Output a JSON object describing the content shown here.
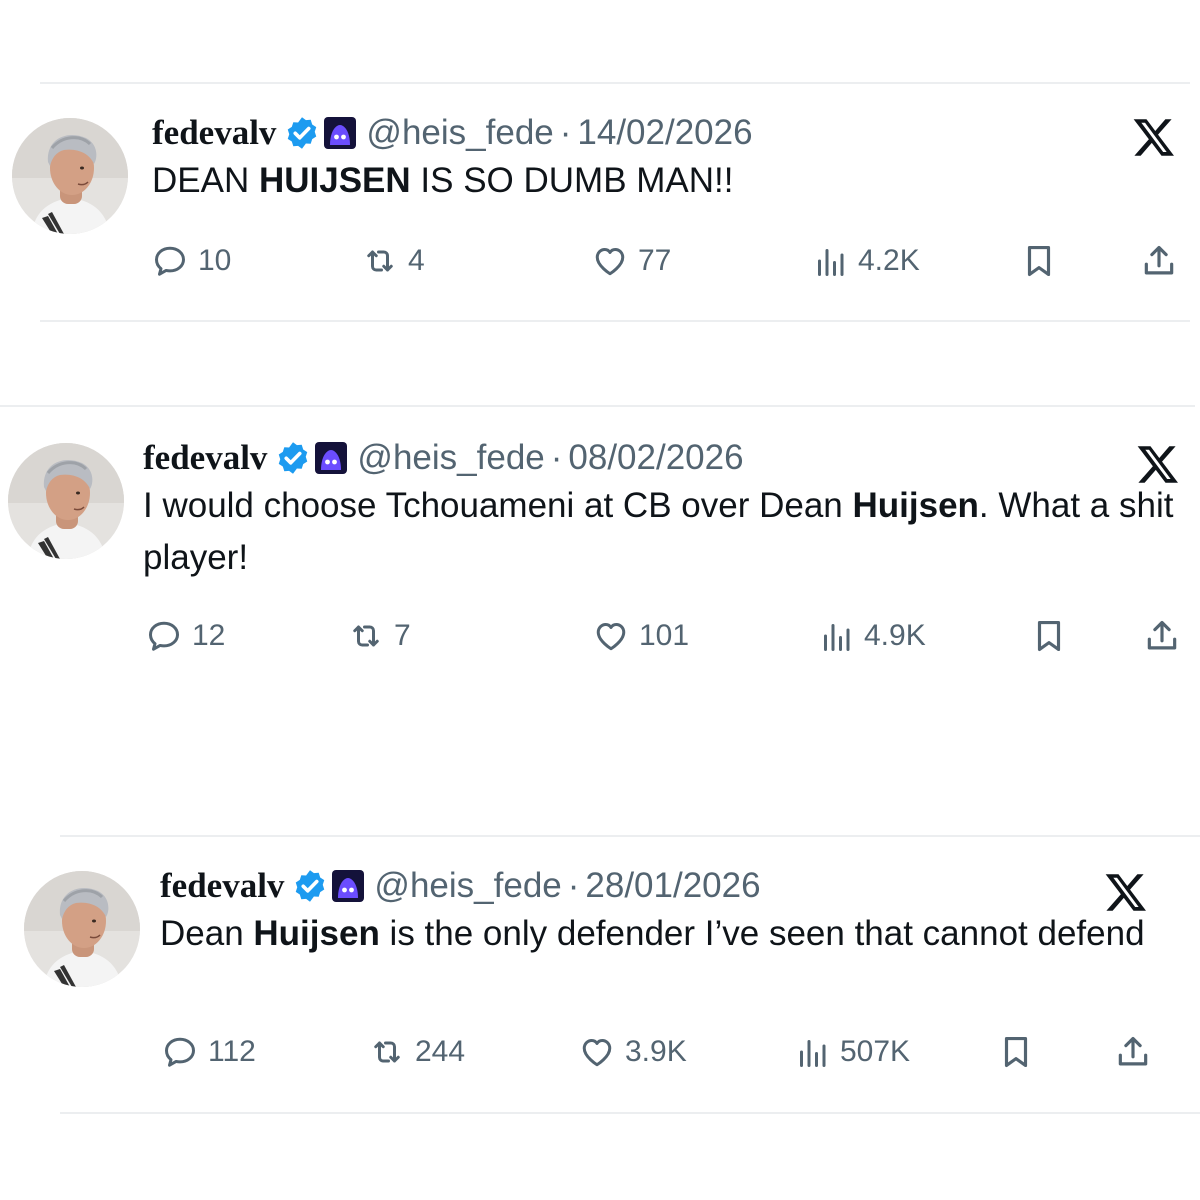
{
  "tweets": [
    {
      "name": "fedevalv",
      "handle": "@heis_fede",
      "separator": "·",
      "date": "14/02/2026",
      "text_parts": [
        {
          "t": "DEAN ",
          "b": false
        },
        {
          "t": "HUIJSEN",
          "b": true
        },
        {
          "t": " IS SO DUMB MAN!!",
          "b": false
        }
      ],
      "replies": "10",
      "reposts": "4",
      "likes": "77",
      "views": "4.2K"
    },
    {
      "name": "fedevalv",
      "handle": "@heis_fede",
      "separator": "·",
      "date": "08/02/2026",
      "text_parts": [
        {
          "t": "I would choose Tchouameni at CB over Dean ",
          "b": false
        },
        {
          "t": "Huijsen",
          "b": true
        },
        {
          "t": ". What a shit player!",
          "b": false
        }
      ],
      "replies": "12",
      "reposts": "7",
      "likes": "101",
      "views": "4.9K"
    },
    {
      "name": "fedevalv",
      "handle": "@heis_fede",
      "separator": "·",
      "date": "28/01/2026",
      "text_parts": [
        {
          "t": "Dean ",
          "b": false
        },
        {
          "t": "Huijsen",
          "b": true
        },
        {
          "t": " is the only defender I’ve seen that cannot defend",
          "b": false
        }
      ],
      "replies": "112",
      "reposts": "244",
      "likes": "3.9K",
      "views": "507K"
    }
  ],
  "icons": {
    "reply": "speech-bubble-icon",
    "repost": "repost-arrows-icon",
    "like": "heart-icon",
    "views": "bar-chart-icon",
    "bookmark": "bookmark-icon",
    "share": "share-upload-icon",
    "verified": "verified-check-icon",
    "badge": "purple-game-badge-icon",
    "logo": "x-logo-icon"
  },
  "colors": {
    "text": "#0f1419",
    "muted": "#536471",
    "verified": "#1d9bf0",
    "divider": "#eceef0"
  }
}
